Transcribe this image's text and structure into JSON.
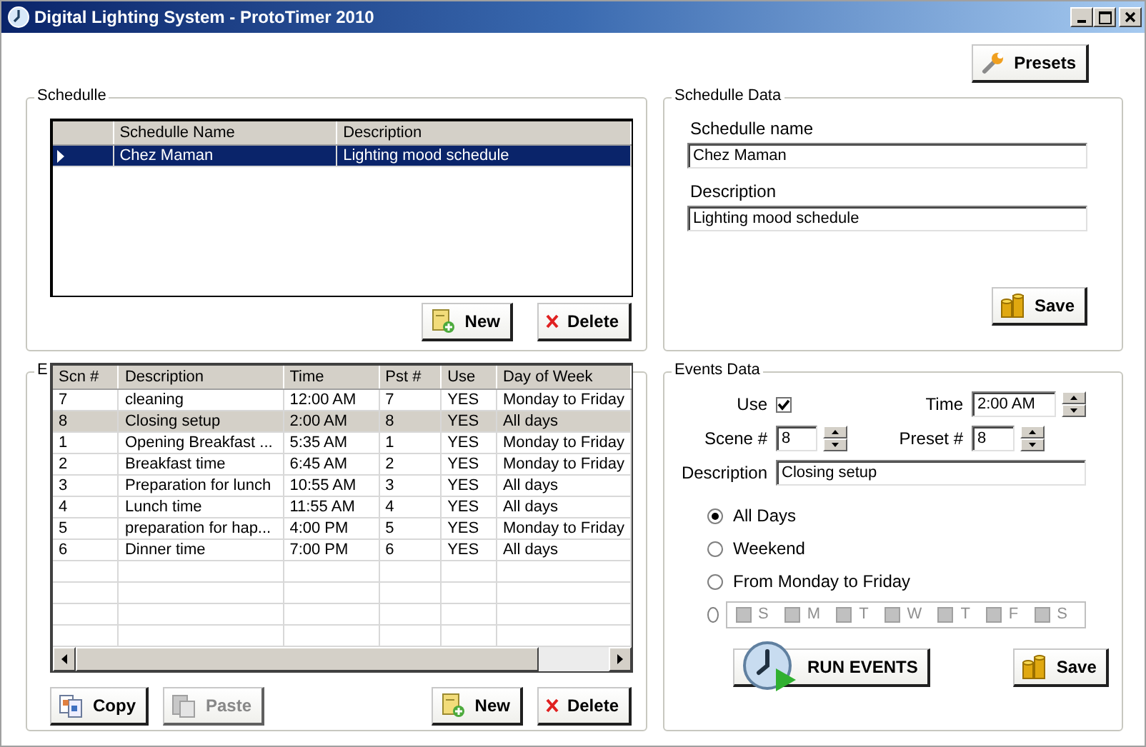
{
  "window": {
    "title": "Digital Lighting System - ProtoTimer 2010"
  },
  "toolbar": {
    "buttons": [
      {
        "label": "Presets",
        "kind": "presets"
      }
    ]
  },
  "schedule": {
    "title": "Schedulle",
    "columns": [
      "Schedulle Name",
      "Description"
    ],
    "rows": [
      {
        "cells": [
          "Chez Maman",
          "Lighting mood schedule"
        ],
        "selected": true
      }
    ],
    "buttons": [
      {
        "label": "New",
        "kind": "new",
        "disabled": false
      },
      {
        "label": "Delete",
        "kind": "delete",
        "disabled": false
      }
    ]
  },
  "schedule_data": {
    "title": "Schedulle Data",
    "fields": [
      {
        "label": "Schedulle name",
        "value": "Chez Maman"
      },
      {
        "label": "Description",
        "value": "Lighting mood schedule"
      }
    ],
    "buttons": [
      {
        "label": "Save",
        "kind": "save"
      }
    ]
  },
  "events": {
    "title": "E",
    "columns": [
      "Scn #",
      "Description",
      "Time",
      "Pst #",
      "Use",
      "Day of Week"
    ],
    "rows": [
      {
        "cells": [
          "7",
          "cleaning",
          "12:00 AM",
          "7",
          "YES",
          "Monday to Friday"
        ],
        "selected": false
      },
      {
        "cells": [
          "8",
          "Closing setup",
          "2:00 AM",
          "8",
          "YES",
          "All days"
        ],
        "selected": true
      },
      {
        "cells": [
          "1",
          "Opening Breakfast ...",
          "5:35 AM",
          "1",
          "YES",
          "Monday to Friday"
        ],
        "selected": false
      },
      {
        "cells": [
          "2",
          "Breakfast time",
          "6:45 AM",
          "2",
          "YES",
          "Monday to Friday"
        ],
        "selected": false
      },
      {
        "cells": [
          "3",
          "Preparation for lunch",
          "10:55 AM",
          "3",
          "YES",
          "All days"
        ],
        "selected": false
      },
      {
        "cells": [
          "4",
          "Lunch time",
          "11:55 AM",
          "4",
          "YES",
          "All days"
        ],
        "selected": false
      },
      {
        "cells": [
          "5",
          "preparation for hap...",
          "4:00 PM",
          "5",
          "YES",
          "Monday to Friday"
        ],
        "selected": false
      },
      {
        "cells": [
          "6",
          "Dinner time",
          "7:00 PM",
          "6",
          "YES",
          "All days"
        ],
        "selected": false
      }
    ],
    "buttons": [
      {
        "label": "Copy",
        "kind": "copy",
        "disabled": false
      },
      {
        "label": "Paste",
        "kind": "paste",
        "disabled": true
      },
      {
        "label": "New",
        "kind": "new",
        "disabled": false
      },
      {
        "label": "Delete",
        "kind": "delete",
        "disabled": false
      }
    ]
  },
  "events_data": {
    "title": "Events Data",
    "use": {
      "label": "Use",
      "checked": true
    },
    "time": {
      "label": "Time",
      "value": "2:00 AM"
    },
    "scene": {
      "label": "Scene #",
      "value": "8"
    },
    "preset": {
      "label": "Preset #",
      "value": "8"
    },
    "description": {
      "label": "Description",
      "value": "Closing setup"
    },
    "day_options": [
      {
        "kind": "label",
        "label": "All Days",
        "selected": true
      },
      {
        "kind": "label",
        "label": "Weekend",
        "selected": false
      },
      {
        "kind": "label",
        "label": "From Monday to Friday",
        "selected": false
      },
      {
        "kind": "custom",
        "selected": false,
        "days": [
          {
            "label": "S",
            "checked": false,
            "disabled": true
          },
          {
            "label": "M",
            "checked": false,
            "disabled": true
          },
          {
            "label": "T",
            "checked": false,
            "disabled": true
          },
          {
            "label": "W",
            "checked": false,
            "disabled": true
          },
          {
            "label": "T",
            "checked": false,
            "disabled": true
          },
          {
            "label": "F",
            "checked": false,
            "disabled": true
          },
          {
            "label": "S",
            "checked": false,
            "disabled": true
          }
        ]
      }
    ],
    "buttons": [
      {
        "label": "RUN EVENTS",
        "kind": "run"
      },
      {
        "label": "Save",
        "kind": "save"
      }
    ]
  }
}
